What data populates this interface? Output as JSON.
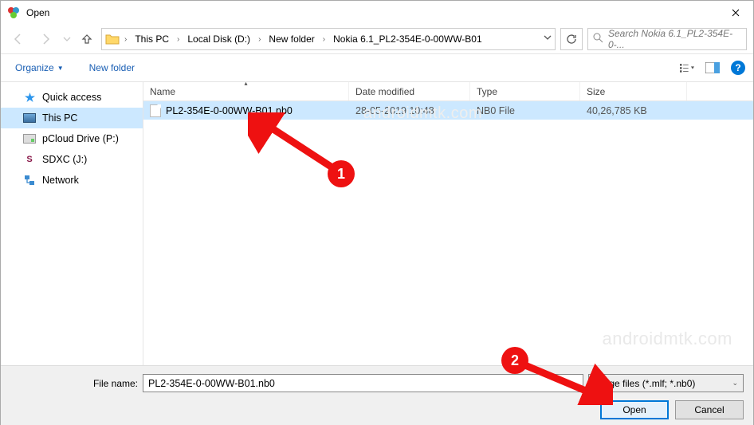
{
  "window": {
    "title": "Open"
  },
  "breadcrumb": {
    "items": [
      "This PC",
      "Local Disk (D:)",
      "New folder",
      "Nokia 6.1_PL2-354E-0-00WW-B01"
    ]
  },
  "search": {
    "placeholder": "Search Nokia 6.1_PL2-354E-0-..."
  },
  "toolbar": {
    "organize": "Organize",
    "newfolder": "New folder"
  },
  "sidebar": {
    "items": [
      {
        "label": "Quick access"
      },
      {
        "label": "This PC"
      },
      {
        "label": "pCloud Drive (P:)"
      },
      {
        "label": "SDXC (J:)"
      },
      {
        "label": "Network"
      }
    ]
  },
  "columns": {
    "name": "Name",
    "date": "Date modified",
    "type": "Type",
    "size": "Size"
  },
  "files": [
    {
      "name": "PL2-354E-0-00WW-B01.nb0",
      "date": "28-05-2019 10:48",
      "type": "NB0 File",
      "size": "40,26,785 KB"
    }
  ],
  "footer": {
    "filename_label": "File name:",
    "filename_value": "PL2-354E-0-00WW-B01.nb0",
    "filter": "image files (*.mlf; *.nb0)",
    "open": "Open",
    "cancel": "Cancel"
  },
  "annotations": {
    "badge1": "1",
    "badge2": "2"
  },
  "watermark": "androidmtk.com"
}
